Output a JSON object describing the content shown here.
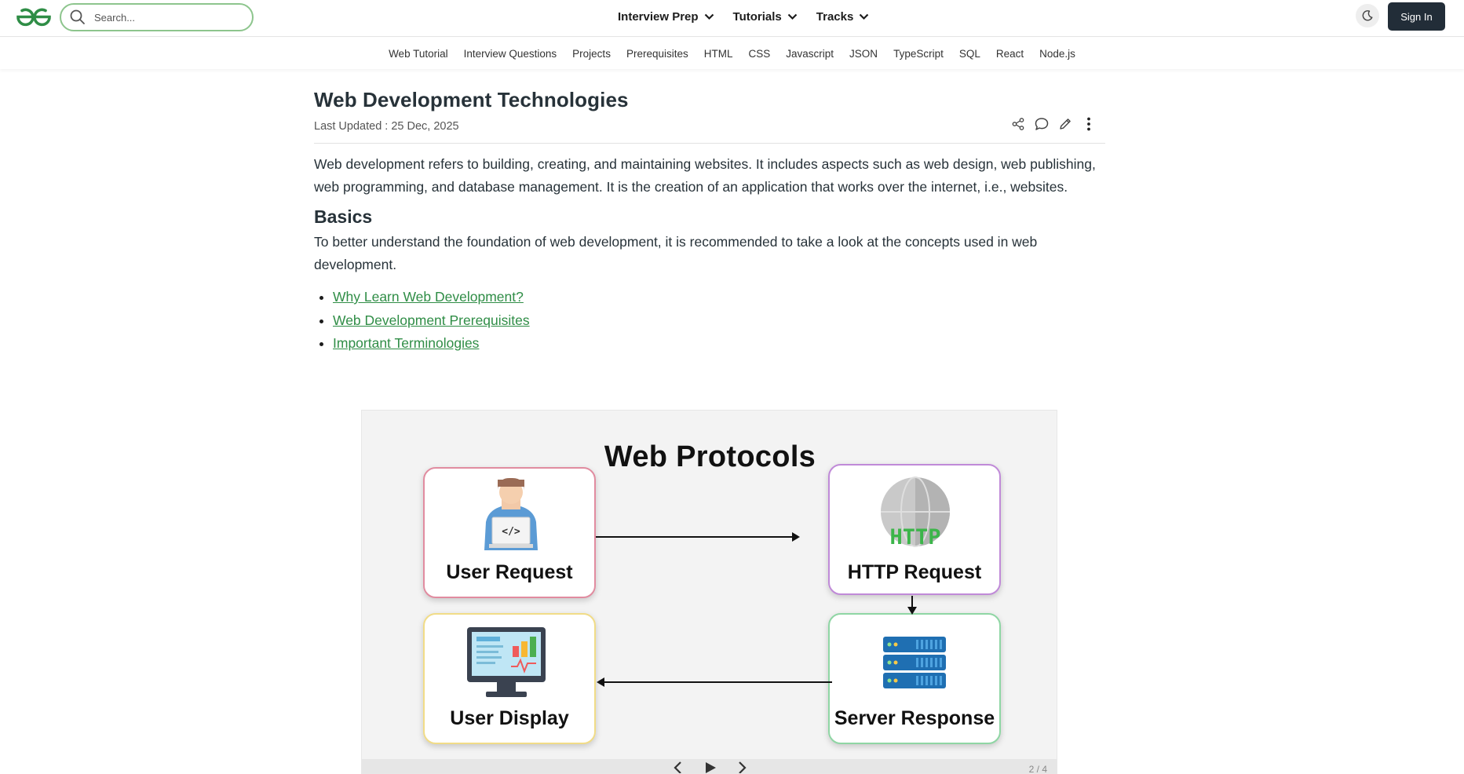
{
  "header": {
    "search_placeholder": "Search...",
    "nav": [
      {
        "label": "Interview Prep"
      },
      {
        "label": "Tutorials"
      },
      {
        "label": "Tracks"
      }
    ],
    "signin_label": "Sign In"
  },
  "subnav": {
    "items": [
      "Web Tutorial",
      "Interview Questions",
      "Projects",
      "Prerequisites",
      "HTML",
      "CSS",
      "Javascript",
      "JSON",
      "TypeScript",
      "SQL",
      "React",
      "Node.js"
    ]
  },
  "article": {
    "title": "Web Development Technologies",
    "updated": "Last Updated : 25 Dec, 2025",
    "intro": "Web development refers to building, creating, and maintaining websites. It includes aspects such as web design, web publishing, web programming, and database management. It is the creation of an application that works over the internet, i.e., websites.",
    "basics_heading": "Basics",
    "basics_text": "To better understand the foundation of web development, it is recommended to take a look at the concepts used in web development.",
    "links": [
      "Why Learn Web Development?",
      "Web Development Prerequisites",
      "Important Terminologies"
    ]
  },
  "slide": {
    "title": "Web Protocols",
    "boxes": {
      "user_request": "User Request",
      "http_request": "HTTP Request",
      "user_display": "User Display",
      "server_response": "Server Response"
    },
    "http_badge": "HTTP",
    "counter": "2 / 4"
  },
  "colors": {
    "brand_green": "#2f8d46",
    "dark_button": "#222d38",
    "box_user_request": "#e18ca0",
    "box_http_request": "#c08ad8",
    "box_user_display": "#f1dc87",
    "box_server_response": "#8fd6a4"
  },
  "icons": {
    "logo": "gfg-logo-icon",
    "search": "search-icon",
    "chevron": "chevron-down-icon",
    "theme": "moon-icon",
    "share": "share-icon",
    "comment": "comment-icon",
    "edit": "pencil-icon",
    "more": "more-vertical-icon"
  }
}
